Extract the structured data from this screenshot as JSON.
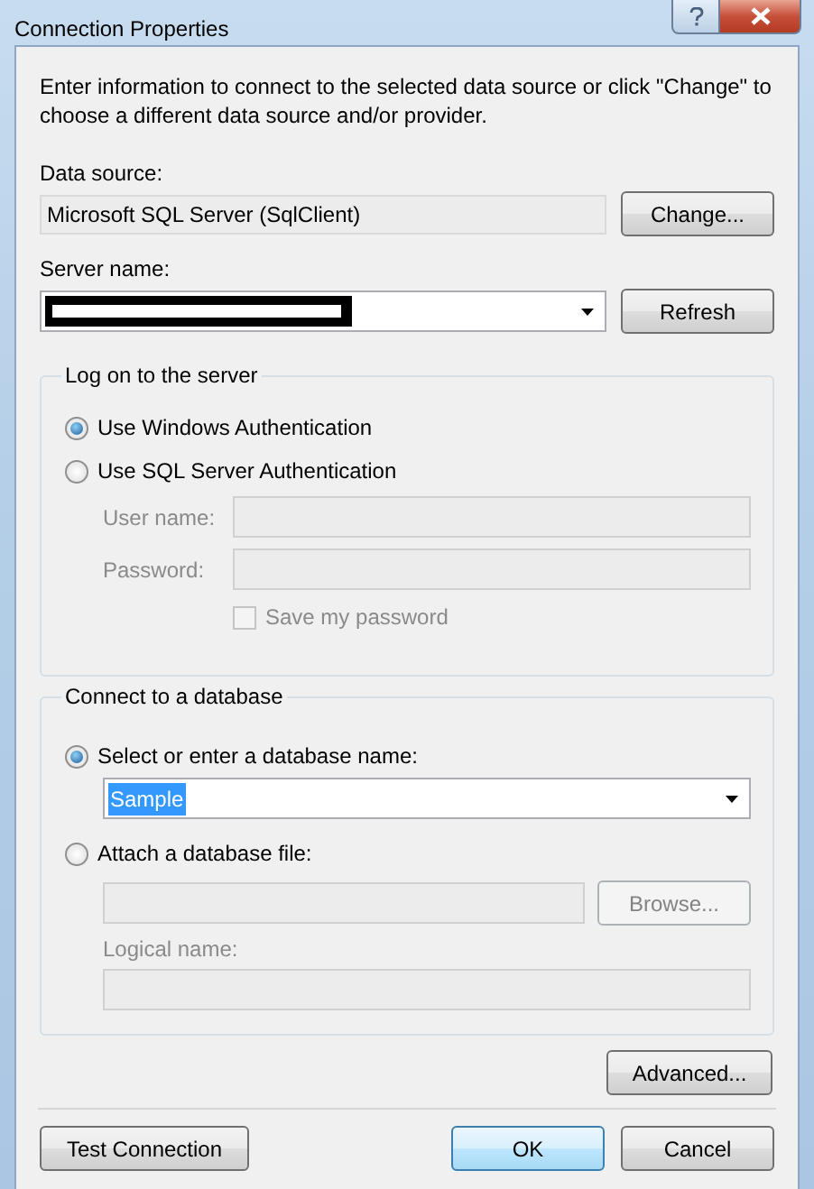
{
  "window": {
    "title": "Connection Properties"
  },
  "intro": "Enter information to connect to the selected data source or click \"Change\" to choose a different data source and/or provider.",
  "data_source": {
    "label": "Data source:",
    "value": "Microsoft SQL Server (SqlClient)",
    "button": "Change..."
  },
  "server_name": {
    "label": "Server name:",
    "redacted": true,
    "button": "Refresh"
  },
  "logon": {
    "title": "Log on to the server",
    "options": [
      {
        "label": "Use Windows Authentication",
        "selected": true
      },
      {
        "label": "Use SQL Server Authentication",
        "selected": false
      }
    ],
    "fields": [
      {
        "label": "User name:",
        "disabled": true
      },
      {
        "label": "Password:",
        "disabled": true
      }
    ],
    "save_password": {
      "label": "Save my password",
      "checked": false,
      "disabled": true
    }
  },
  "database": {
    "title": "Connect to a database",
    "options": [
      {
        "label": "Select or enter a database name:",
        "selected": true
      },
      {
        "label": "Attach a database file:",
        "selected": false
      }
    ],
    "database_name": {
      "value": "Sample",
      "highlighted": true
    },
    "file": {
      "disabled": true,
      "button": "Browse...",
      "button_disabled": true
    },
    "logical_name": {
      "label": "Logical name:",
      "disabled": true
    }
  },
  "advanced_button": "Advanced...",
  "footer_buttons": [
    {
      "label": "Test Connection",
      "focused": false
    },
    {
      "label": "OK",
      "focused": true
    },
    {
      "label": "Cancel",
      "focused": false
    }
  ]
}
